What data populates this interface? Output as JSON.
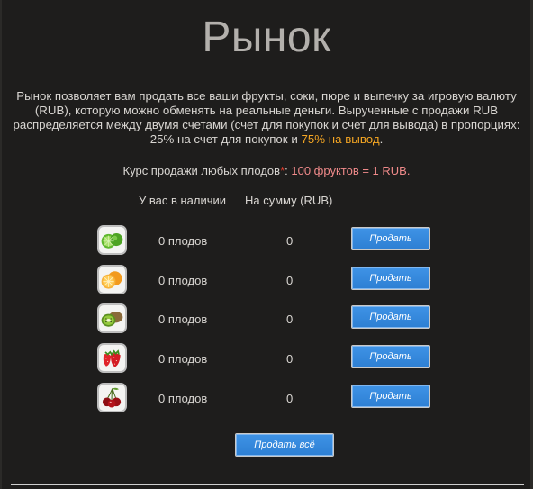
{
  "page": {
    "title": "Рынок",
    "description_lines": [
      "Рынок позволяет вам продать все ваши фрукты, соки, пюре и выпечку за игровую валюту",
      "(RUB), которую можно обменять на реальные деньги. Выpученные с продажи RUB",
      "распределяется между двумя счетами (счет для покупок и счет для вывода) в пропорциях:"
    ],
    "description_last_prefix": "25% на счет для покупок и ",
    "description_last_highlight": "75% на вывод",
    "description_last_suffix": ".",
    "rate_label": "Курс продажи любых плодов",
    "rate_star": "*",
    "rate_colon": ": ",
    "rate_value": "100 фруктов = 1 RUB",
    "rate_dot": "."
  },
  "table": {
    "col_available": "У вас в наличии",
    "col_sum": "На сумму (RUB)",
    "rows": [
      {
        "fruit_icon": "lime-icon",
        "count": "0 плодов",
        "sum": "0",
        "button": "Продать"
      },
      {
        "fruit_icon": "orange-icon",
        "count": "0 плодов",
        "sum": "0",
        "button": "Продать"
      },
      {
        "fruit_icon": "kiwi-icon",
        "count": "0 плодов",
        "sum": "0",
        "button": "Продать"
      },
      {
        "fruit_icon": "strawberry-icon",
        "count": "0 плодов",
        "sum": "0",
        "button": "Продать"
      },
      {
        "fruit_icon": "cherry-icon",
        "count": "0 плодов",
        "sum": "0",
        "button": "Продать"
      }
    ],
    "sell_all_button": "Продать всё"
  },
  "colors": {
    "background": "#1e1d1c",
    "accent_orange": "#f5a623",
    "accent_red": "#e33a2a",
    "button_blue": "#3388dd"
  }
}
